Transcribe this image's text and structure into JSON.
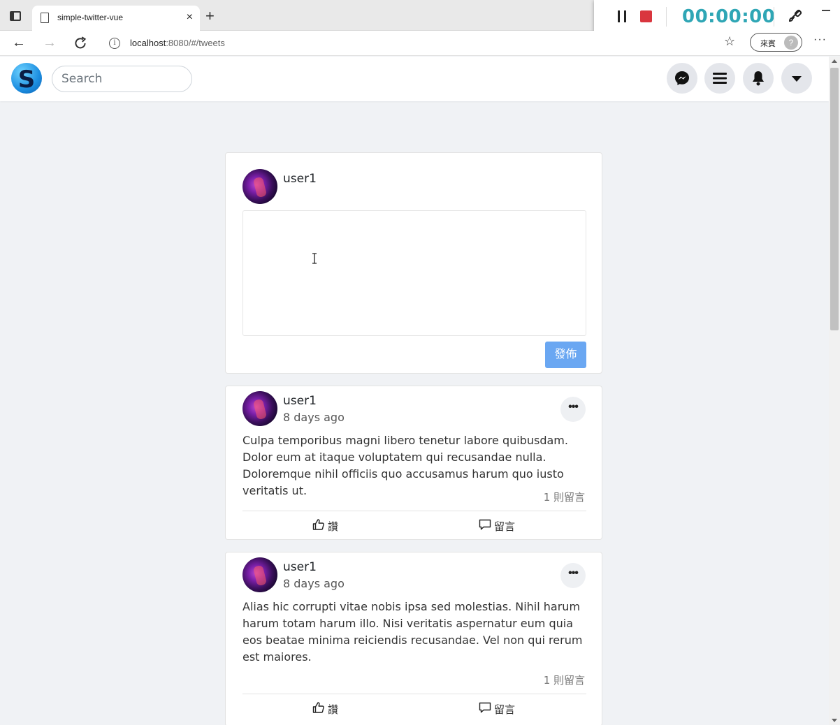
{
  "browser": {
    "tab_title": "simple-twitter-vue",
    "tab_close": "×",
    "new_tab": "+",
    "url_host": "localhost",
    "url_rest": ":8080/#/tweets",
    "guest_label": "來賓",
    "more": "···"
  },
  "recorder": {
    "time": "00:00:00",
    "stop_color": "#d9363e",
    "time_color": "#2fa6b5"
  },
  "navbar": {
    "logo_letter": "S",
    "search_placeholder": "Search",
    "icons": [
      "messenger-icon",
      "menu-icon",
      "bell-icon",
      "caret-down-icon"
    ]
  },
  "composer": {
    "username": "user1",
    "post_label": "發佈",
    "post_color": "#6aa7f2"
  },
  "tweets": [
    {
      "username": "user1",
      "time": "8 days ago",
      "text": "Culpa temporibus magni libero tenetur labore quibusdam. Dolor eum at itaque voluptatem qui recusandae nulla. Doloremque nihil officiis quo accusamus harum quo iusto veritatis ut.",
      "reply_count": "1 則留言",
      "like_label": "讚",
      "comment_label": "留言"
    },
    {
      "username": "user1",
      "time": "8 days ago",
      "text": "Alias hic corrupti vitae nobis ipsa sed molestias. Nihil harum harum totam harum illo. Nisi veritatis aspernatur eum quia eos beatae minima reiciendis recusandae. Vel non qui rerum est maiores.",
      "reply_count": "1 則留言",
      "like_label": "讚",
      "comment_label": "留言"
    }
  ]
}
